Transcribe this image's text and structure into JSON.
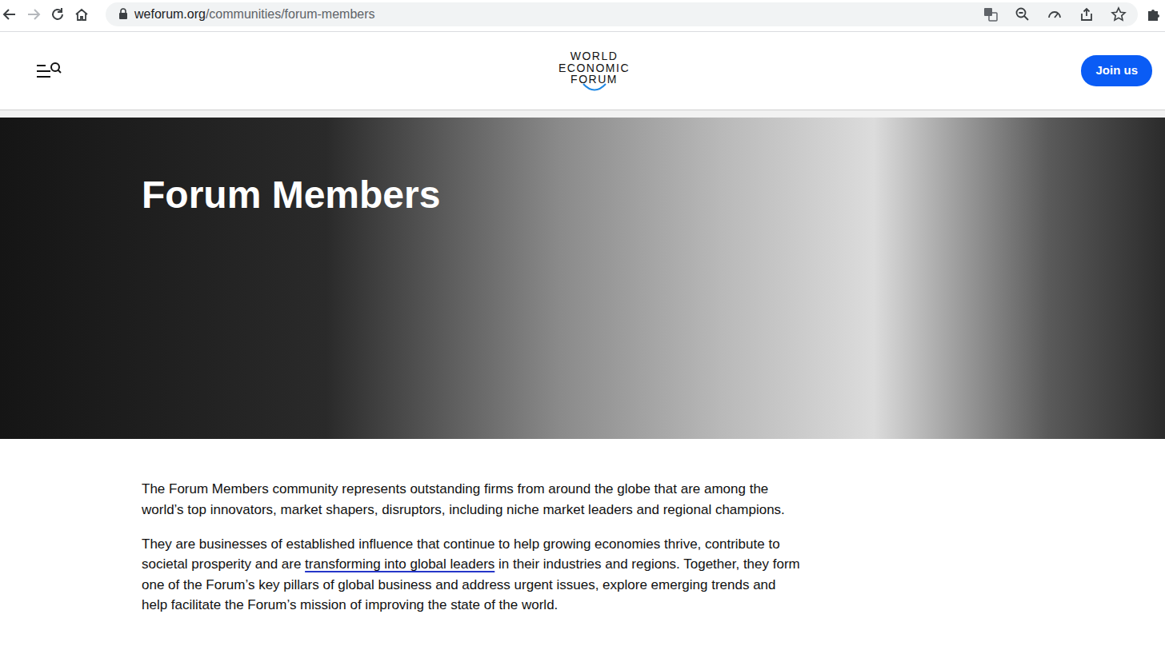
{
  "browser": {
    "url_host": "weforum.org",
    "url_path": "/communities/forum-members"
  },
  "header": {
    "logo_lines": [
      "WORLD",
      "ECONOMIC",
      "FORUM"
    ],
    "join_button": "Join us"
  },
  "hero": {
    "title": "Forum Members"
  },
  "content": {
    "paragraphs": [
      {
        "segments": [
          {
            "text": "The Forum Members community represents outstanding firms from around the globe that are among the world’s top innovators, market shapers, disruptors, including niche market leaders and regional champions.",
            "link": false
          }
        ]
      },
      {
        "segments": [
          {
            "text": "They are businesses of established influence that continue to help growing economies thrive, contribute to societal prosperity and are ",
            "link": false
          },
          {
            "text": "transforming into global leaders",
            "link": true
          },
          {
            "text": " in their industries and regions. Together, they form one of the Forum’s key pillars of global business and address urgent issues, explore emerging trends and help facilitate the Forum’s mission of improving the state of the world.",
            "link": false
          }
        ]
      }
    ]
  }
}
